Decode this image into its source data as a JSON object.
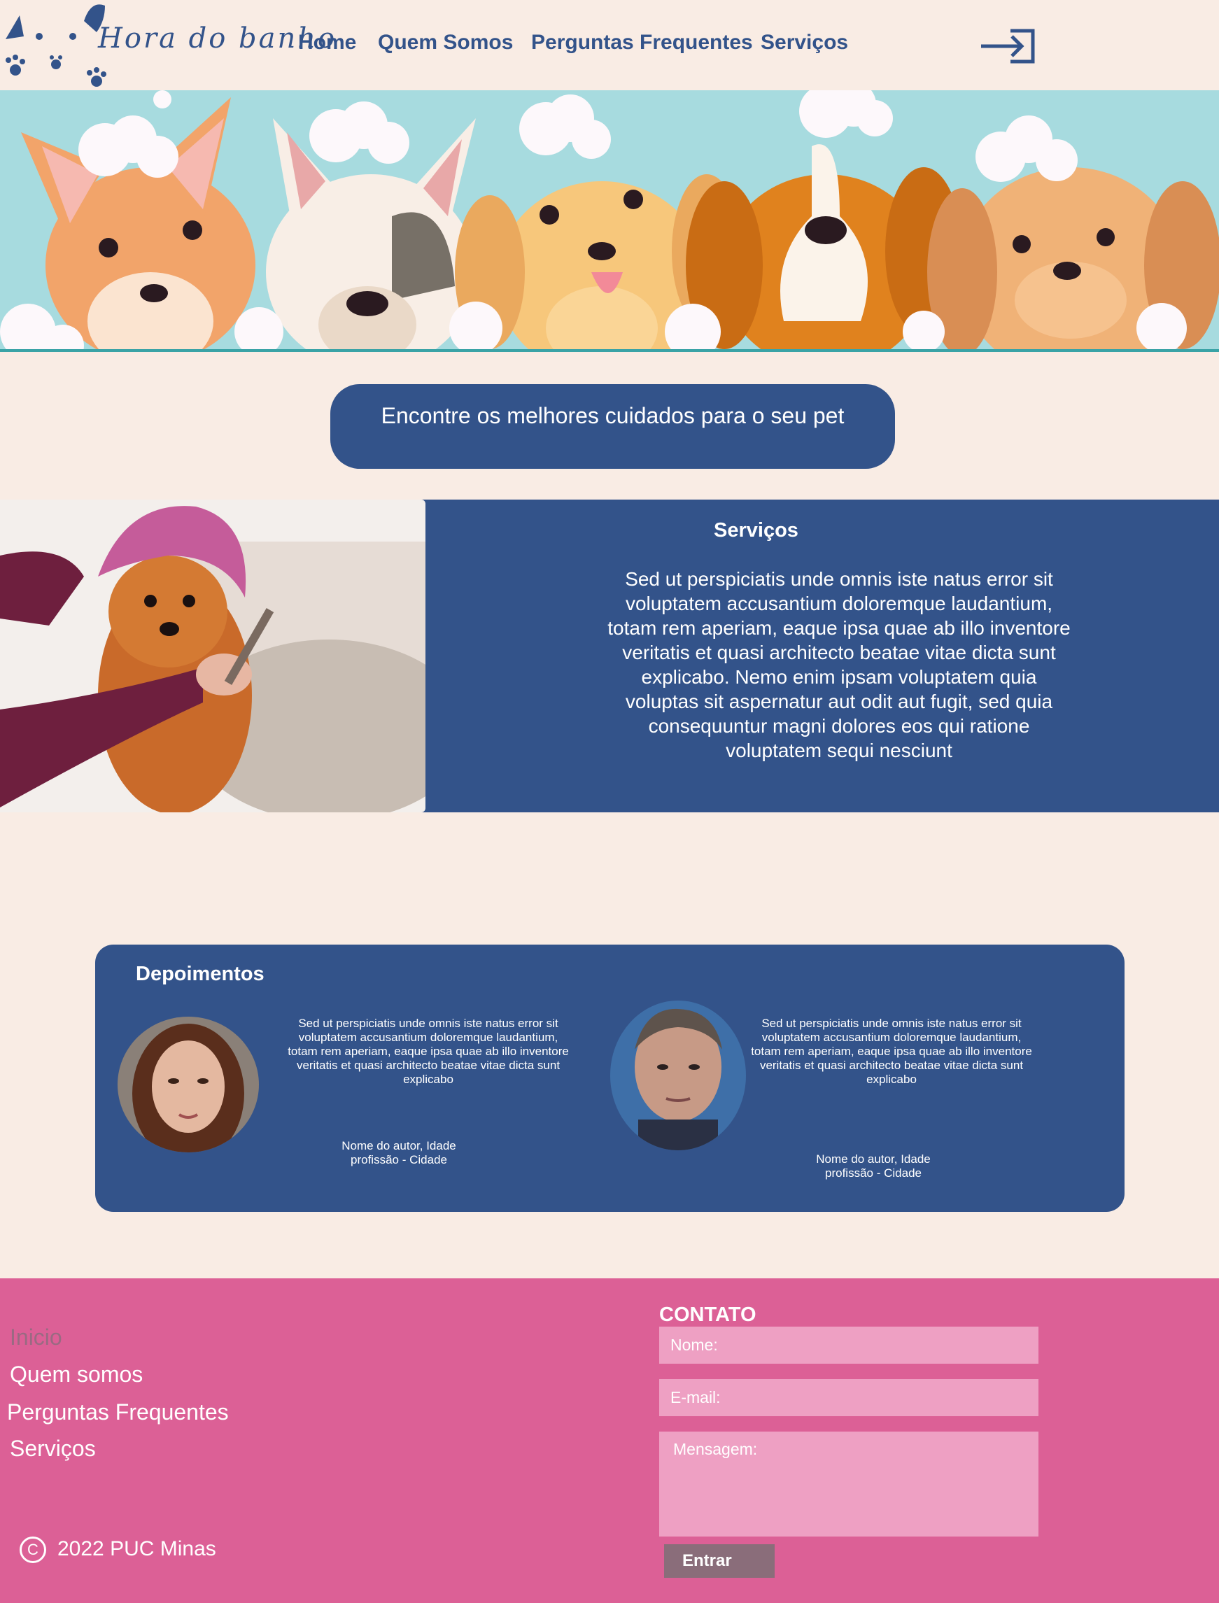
{
  "header": {
    "brand": "Hora do banho",
    "nav": [
      "Home",
      "Quem Somos",
      "Perguntas Frequentes",
      "Serviços"
    ],
    "login_icon": "login-arrow-icon",
    "logo_icon": "paw-prints-logo-icon"
  },
  "hero": {
    "image": "cartoon-dogs-bath-banner"
  },
  "slogan": "Encontre os melhores cuidados para o seu pet",
  "services": {
    "title": "Serviços",
    "text": "Sed ut perspiciatis unde omnis iste natus error sit voluptatem accusantium doloremque laudantium, totam rem aperiam, eaque ipsa quae ab illo inventore veritatis et quasi architecto beatae vitae dicta sunt explicabo. Nemo enim ipsam voluptatem quia voluptas sit aspernatur aut odit aut fugit, sed quia consequuntur magni dolores eos qui ratione voluptatem sequi nesciunt",
    "image": "dog-with-towel-photo"
  },
  "testimonials": {
    "title": "Depoimentos",
    "items": [
      {
        "text": "Sed ut perspiciatis unde omnis iste natus error sit voluptatem accusantium doloremque laudantium, totam rem aperiam, eaque ipsa quae ab illo inventore veritatis et quasi architecto beatae vitae dicta sunt explicabo",
        "author": "Nome  do autor, Idade",
        "role": "profissão - Cidade",
        "avatar": "woman-avatar"
      },
      {
        "text": "Sed ut perspiciatis unde omnis iste natus error sit voluptatem accusantium doloremque laudantium, totam rem aperiam, eaque ipsa quae ab illo inventore veritatis et quasi architecto beatae vitae dicta sunt explicabo",
        "author": "Nome  do autor, Idade",
        "role": "profissão - Cidade",
        "avatar": "man-avatar"
      }
    ]
  },
  "footer": {
    "links": [
      "Inicio",
      "Quem somos",
      "Perguntas Frequentes",
      "Serviços"
    ],
    "copyright": "2022 PUC Minas",
    "contact": {
      "title": "CONTATO",
      "name_placeholder": "Nome:",
      "email_placeholder": "E-mail:",
      "message_placeholder": "Mensagem:",
      "submit": "Entrar"
    }
  },
  "colors": {
    "background": "#f9ece4",
    "primary_blue": "#33538a",
    "footer_pink": "#dc6096",
    "field_pink": "#eea0c3",
    "hero_teal": "#a7dbdf"
  }
}
